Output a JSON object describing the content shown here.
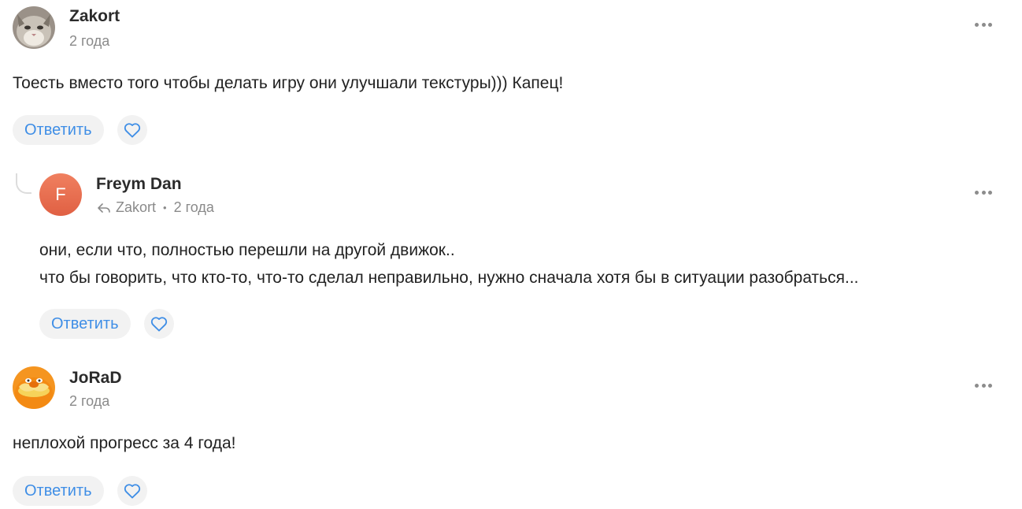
{
  "comments": [
    {
      "author": "Zakort",
      "time": "2 года",
      "text_lines": [
        "Тоесть вместо того чтобы делать игру они улучшали текстуры))) Капец!"
      ],
      "reply_label": "Ответить",
      "avatar_icon": "cat-avatar"
    },
    {
      "author": "Freym Dan",
      "reply_to": "Zakort",
      "separator": "•",
      "time": "2 года",
      "avatar_letter": "F",
      "text_lines": [
        "они, если что, полностью перешли на другой движок..",
        "что бы говорить, что кто-то, что-то сделал неправильно, нужно сначала хотя бы в ситуации разобраться..."
      ],
      "reply_label": "Ответить"
    },
    {
      "author": "JoRaD",
      "time": "2 года",
      "text_lines": [
        "неплохой прогресс за 4 года!"
      ],
      "reply_label": "Ответить",
      "avatar_icon": "lorax-avatar"
    }
  ],
  "colors": {
    "accent": "#3f8ee6",
    "button_bg": "#f2f2f2",
    "meta_text": "#8a8a8a"
  }
}
